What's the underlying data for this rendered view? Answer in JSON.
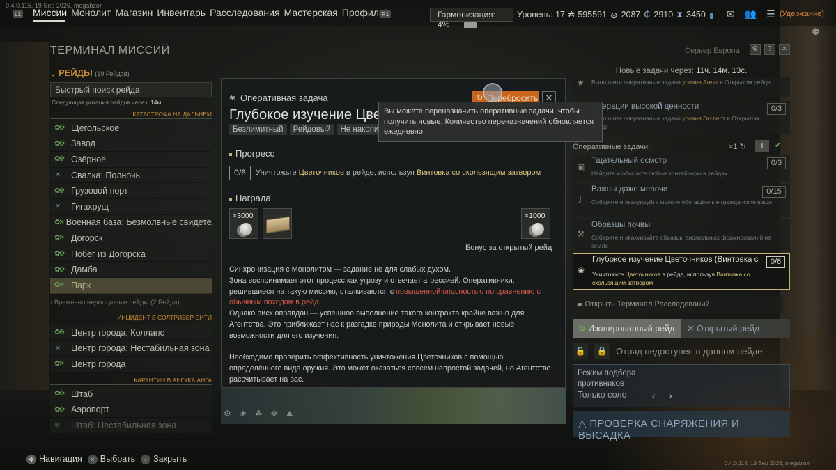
{
  "build": "0.4.0.115, 19 Sep 2026, megabzor",
  "buttons": {
    "l1": "L1",
    "r1": "R1"
  },
  "nav": {
    "items": [
      "Миссии",
      "Монолит",
      "Магазин",
      "Инвентарь",
      "Расследования",
      "Мастерская",
      "Профиль"
    ],
    "active_index": 0
  },
  "status": {
    "harmonization": "Гармонизация: 4%",
    "level": "Уровень: 17",
    "currency1": "595591",
    "currency2": "2087",
    "currency3": "2910",
    "currency4": "3450",
    "hold": "(Удержание)"
  },
  "terminal_title": "ТЕРМИНАЛ МИССИЙ",
  "raids": {
    "header": "РЕЙДЫ",
    "count": "(19 Рейдов)",
    "search_placeholder": "Быстрый поиск рейда",
    "rotation_label": "Следующая ротация рейдов через:",
    "rotation_time": "14м.",
    "sections": [
      {
        "title": "КАТАСТРОФА НА ДАЛЬНЕМ",
        "items": [
          "Щегольское",
          "Завод",
          "Озёрное",
          "Свалка: Полночь",
          "Грузовой порт",
          "Гигахрущ",
          "Военная база: Безмолвные свидетели",
          "Догорск",
          "Побег из Догорска",
          "Дамба",
          "Парк"
        ]
      },
      {
        "title": "ИНЦИДЕНТ В СОЛТРИВЕР СИТИ",
        "items": [
          "Центр города: Коллапс",
          "Центр города: Нестабильная зона",
          "Центр города"
        ]
      },
      {
        "title": "КАРАНТИН В АНГУКА АНГА",
        "items": [
          "Штаб",
          "Аэропорт",
          "Штаб: Нестабильная зона"
        ]
      }
    ],
    "unavailable": "Временно недоступные рейды",
    "unavailable_count": "(2 Рейда)"
  },
  "right": {
    "server": "Сервер Европа",
    "new_tasks_label": "Новые задачи через:",
    "new_tasks_time": "11ч. 14м. 13с.",
    "top_cards": [
      {
        "title": "",
        "desc_pre": "Выполните оперативные задачи ",
        "desc_hi": "уровня Агент",
        "desc_post": " в Открытом рейде",
        "count": ""
      },
      {
        "title": "Операции высокой ценности",
        "desc_pre": "Выполните оперативные задачи ",
        "desc_hi": "уровня Эксперт",
        "desc_post": " в Открытом рейде",
        "count": "0/3"
      }
    ],
    "op_header": "Оперативные задачи:",
    "op_rerolls": "×1",
    "op_cards": [
      {
        "title": "Тщательный осмотр",
        "desc": "Найдите и обыщите любые контейнеры в рейдах",
        "count": "0/3"
      },
      {
        "title": "Важны даже мелочи",
        "desc": "Соберите и эвакуируйте мелкие обогащённые гражданские вещи",
        "count": "0/15"
      },
      {
        "title": "Образцы почвы",
        "desc": "Соберите и эвакуируйте образцы аномальных формирований на земле",
        "count": ""
      }
    ],
    "active_card": {
      "title": "Глубокое изучение Цветочников (Винтовка со скользящим затвором)",
      "desc_pre": "Уничтожьте ",
      "desc_hi1": "Цветочников",
      "desc_mid": " в рейде, используя ",
      "desc_hi2": "Винтовка со скользящим затвором",
      "count": "0/6"
    },
    "open_terminal": "Открыть Терминал Расследований",
    "tab_isolated": "Изолированный рейд",
    "tab_open": "Открытый рейд",
    "squad_unavailable": "Отряд недоступен в данном рейде",
    "matchmaking_label": "Режим подбора противников",
    "matchmaking_value": "Только соло",
    "deploy": "ПРОВЕРКА СНАРЯЖЕНИЯ И ВЫСАДКА"
  },
  "modal": {
    "kind": "Оперативная задача",
    "reset": "Перебросить",
    "title": "Глубокое изучение Цветочников (Винтовка со скользящим затвором)",
    "tags": [
      "Безлимитный",
      "Рейдовый",
      "Не накопительный"
    ],
    "progress_header": "Прогресс",
    "progress_value": "0/6",
    "progress_pre": "Уничтожьте ",
    "progress_hi1": "Цветочников",
    "progress_mid": " в рейде, используя ",
    "progress_hi2": "Винтовка со скользящим затвором",
    "reward_header": "Награда",
    "reward_qty1": "×3000",
    "reward_qty2": "×1000",
    "bonus": "Бонус за открытый рейд",
    "desc1": "Синхронизация с Монолитом — задание не для слабых духом.",
    "desc2": "Зона воспринимает этот процесс как угрозу и отвечает агрессией. Оперативники, решившиеся на такую миссию, сталкиваются с ",
    "desc2_red": "повышенной опасностью по сравнению с обычным походом в рейд",
    "desc2_end": ".",
    "desc3": "Однако риск оправдан — успешное выполнение такого контракта крайне важно для Агентства. Это приближает нас к разгадке природы Монолита и открывает новые возможности для его изучения.",
    "desc4": "Необходимо проверить эффективность уничтожения Цветочников с помощью определённого вида оружия. Это может оказаться совсем непростой задачей, но Агентство рассчитывает на вас."
  },
  "tooltip": "Вы можете переназначить оперативные задачи, чтобы получить новые. Количество переназначений обновляется ежедневно.",
  "hints": {
    "navigate": "Навигация",
    "select": "Выбрать",
    "close": "Закрыть"
  }
}
